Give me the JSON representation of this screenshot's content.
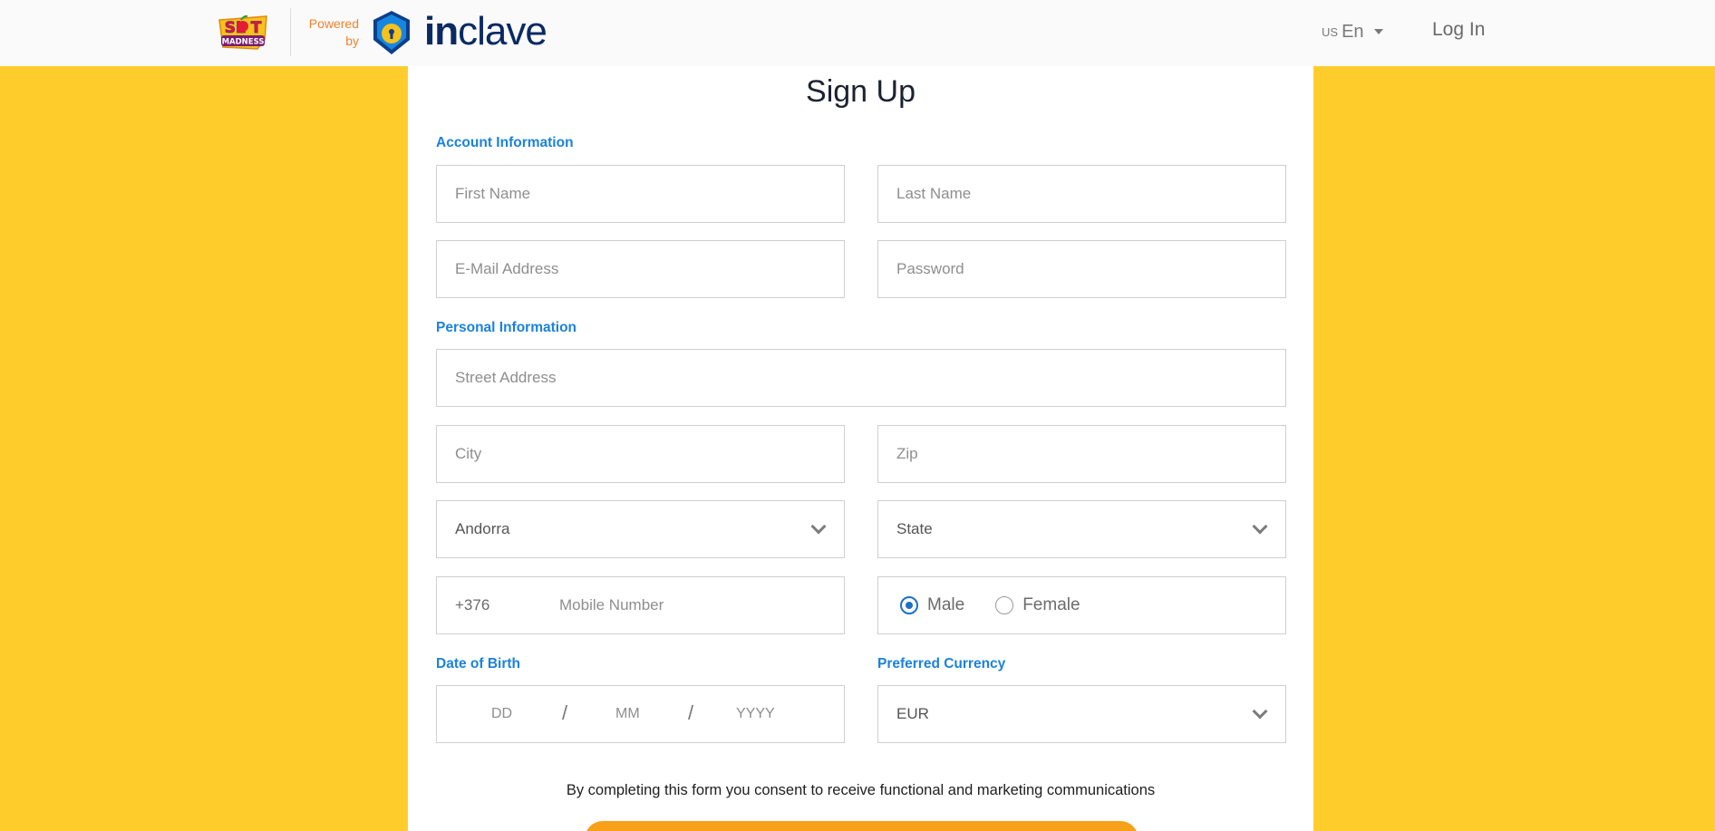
{
  "header": {
    "brand_alt": "Slot Madness",
    "brand_text_top": "SL T",
    "brand_text_bottom": "MADNESS",
    "powered_by": "Powered by",
    "partner_bold": "in",
    "partner_rest": "clave",
    "language_country": "US",
    "language": "En",
    "login_label": "Log In"
  },
  "form": {
    "title": "Sign Up",
    "account_section": "Account Information",
    "first_name_placeholder": "First Name",
    "last_name_placeholder": "Last Name",
    "email_placeholder": "E-Mail Address",
    "password_placeholder": "Password",
    "personal_section": "Personal Information",
    "street_placeholder": "Street Address",
    "city_placeholder": "City",
    "zip_placeholder": "Zip",
    "country_value": "Andorra",
    "state_value": "State",
    "phone_code": "+376",
    "mobile_placeholder": "Mobile Number",
    "gender_options": [
      "Male",
      "Female"
    ],
    "gender_selected": "Male",
    "dob_label": "Date of Birth",
    "dob_day": "DD",
    "dob_month": "MM",
    "dob_year": "YYYY",
    "dob_separator": "/",
    "currency_label": "Preferred Currency",
    "currency_value": "EUR",
    "consent_text": "By completing this form you consent to receive functional and marketing communications"
  },
  "colors": {
    "background": "#fecd2c",
    "accent_blue": "#1b82db",
    "powered_orange": "#f0832a",
    "submit_orange": "#f7a11b"
  }
}
